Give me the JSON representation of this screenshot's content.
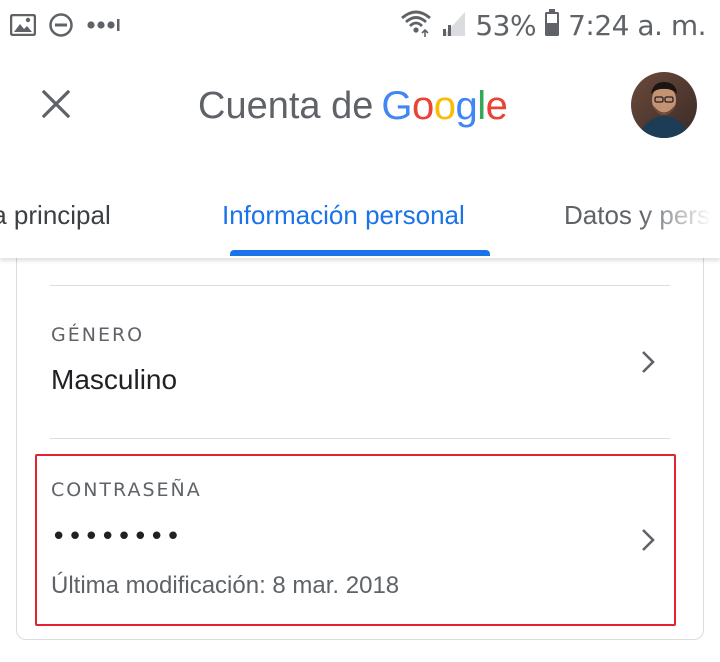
{
  "status_bar": {
    "battery": "53%",
    "time": "7:24 a. m.",
    "icons": [
      "image-icon",
      "do-not-disturb-icon",
      "more-dots-icon",
      "wifi-icon",
      "signal-icon",
      "battery-icon"
    ]
  },
  "header": {
    "title_prefix": "Cuenta de",
    "brand_letters": [
      "G",
      "o",
      "o",
      "g",
      "l",
      "e"
    ],
    "brand_colors": [
      "#4285F4",
      "#EA4335",
      "#FBBC05",
      "#4285F4",
      "#34A853",
      "#EA4335"
    ],
    "close_icon": "close-icon"
  },
  "tabs": {
    "items": [
      {
        "label": "ina principal"
      },
      {
        "label": "Información personal",
        "active": true
      },
      {
        "label": "Datos y pers"
      }
    ],
    "active_color": "#1a73e8"
  },
  "card": {
    "gender": {
      "label": "GÉNERO",
      "value": "Masculino"
    },
    "password": {
      "label": "CONTRASEÑA",
      "value": "••••••••",
      "last_modified": "Última modificación: 8 mar. 2018"
    },
    "highlight_color": "#e0232e"
  }
}
